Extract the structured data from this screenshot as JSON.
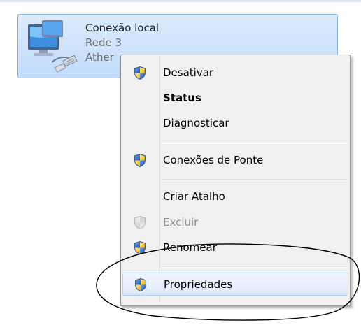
{
  "adapter": {
    "name": "Conexão local",
    "network": "Rede  3",
    "device_truncated": "Ather"
  },
  "context_menu": {
    "items": [
      {
        "label": "Desativar",
        "icon": "uac-shield-icon"
      },
      {
        "label": "Status",
        "bold": true
      },
      {
        "label": "Diagnosticar"
      },
      {
        "label": "Conexões de Ponte",
        "icon": "uac-shield-icon"
      },
      {
        "label": "Criar Atalho"
      },
      {
        "label": "Excluir",
        "icon": "uac-shield-icon",
        "disabled": true
      },
      {
        "label": "Renomear",
        "icon": "uac-shield-icon"
      },
      {
        "label": "Propriedades",
        "icon": "uac-shield-icon",
        "highlighted": true
      }
    ]
  },
  "colors": {
    "selection_border": "#84acdd",
    "annotation_ellipse": "#000000"
  }
}
